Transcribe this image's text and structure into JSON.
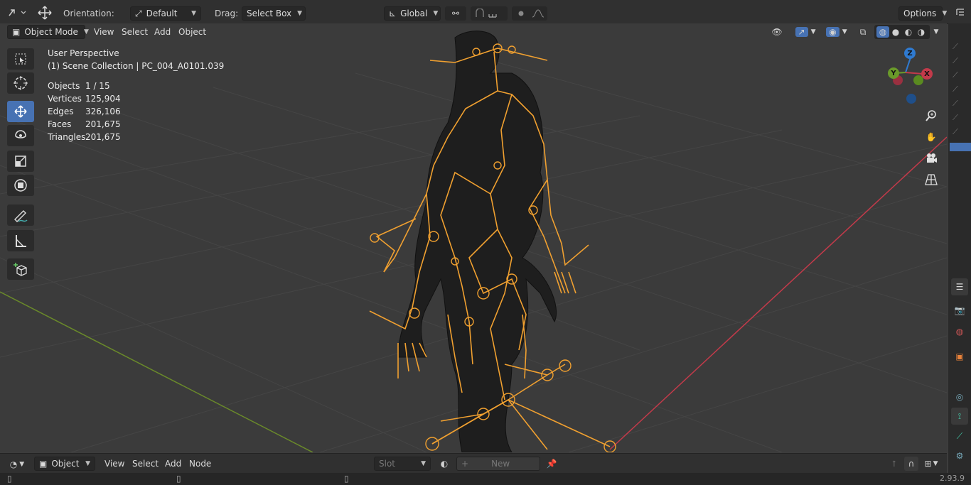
{
  "top_header": {
    "orientation_label": "Orientation:",
    "orientation_value": "Default",
    "drag_label": "Drag:",
    "drag_value": "Select Box",
    "transform_orientation": "Global",
    "options_label": "Options"
  },
  "viewport_header": {
    "mode": "Object Mode",
    "menu": [
      "View",
      "Select",
      "Add",
      "Object"
    ]
  },
  "overlay": {
    "perspective": "User Perspective",
    "collection": "(1) Scene Collection | PC_004_A0101.039",
    "stats": [
      {
        "label": "Objects",
        "value": "1 / 15"
      },
      {
        "label": "Vertices",
        "value": "125,904"
      },
      {
        "label": "Edges",
        "value": "326,106"
      },
      {
        "label": "Faces",
        "value": "201,675"
      },
      {
        "label": "Triangles",
        "value": "201,675"
      }
    ]
  },
  "gizmo": {
    "z": "Z",
    "y": "Y",
    "x": "X"
  },
  "bottom_header": {
    "object_type": "Object",
    "menu": [
      "View",
      "Select",
      "Add",
      "Node"
    ],
    "slot": "Slot",
    "new_label": "New"
  },
  "status": {
    "version": "2.93.9"
  },
  "colors": {
    "accent": "#4772b3",
    "armature": "#f0a030",
    "x_axis": "#c23a4a",
    "y_axis": "#6a8a2a"
  }
}
